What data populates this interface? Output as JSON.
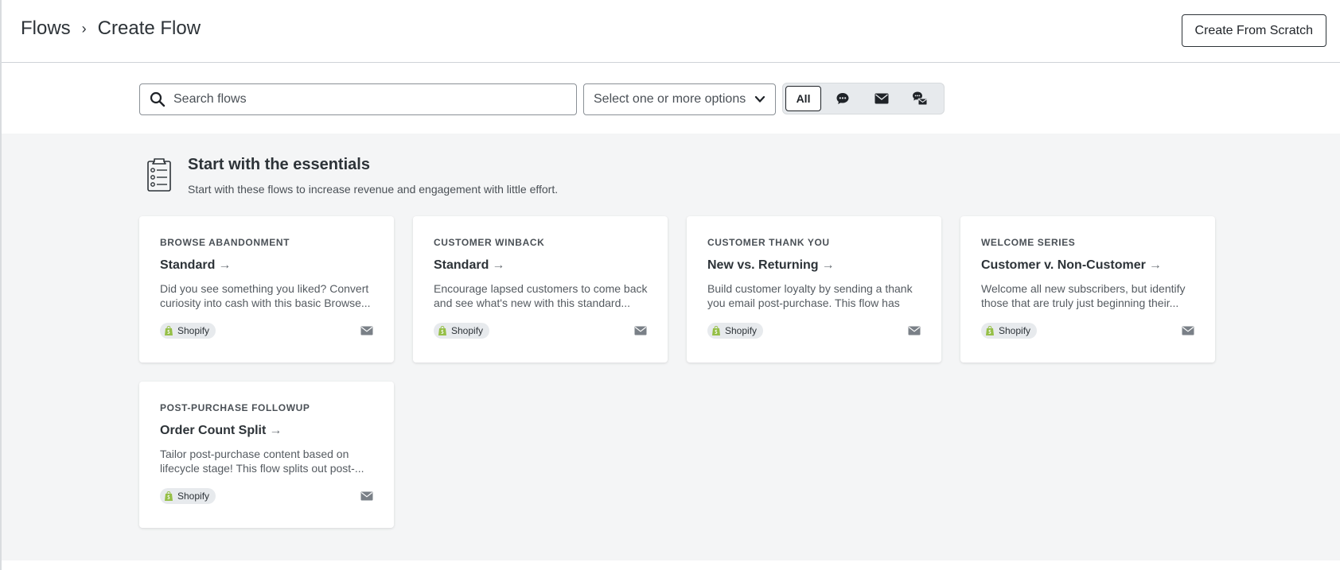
{
  "header": {
    "breadcrumb_root": "Flows",
    "breadcrumb_separator": "›",
    "breadcrumb_current": "Create Flow",
    "create_button": "Create From Scratch"
  },
  "toolbar": {
    "search_placeholder": "Search flows",
    "select_placeholder": "Select one or more options",
    "filters": [
      {
        "label": "All",
        "icon": null,
        "active": true
      },
      {
        "label": "",
        "icon": "sms-icon",
        "active": false
      },
      {
        "label": "",
        "icon": "email-icon",
        "active": false
      },
      {
        "label": "",
        "icon": "sms-email-icon",
        "active": false
      }
    ]
  },
  "section": {
    "title": "Start with the essentials",
    "subtitle": "Start with these flows to increase revenue and engagement with little effort.",
    "icon": "clipboard-list-icon"
  },
  "cards": [
    {
      "category": "BROWSE ABANDONMENT",
      "name": "Standard",
      "description": "Did you see something you liked? Convert curiosity into cash with this basic Browse...",
      "tag": "Shopify",
      "channel": "email-icon"
    },
    {
      "category": "CUSTOMER WINBACK",
      "name": "Standard",
      "description": "Encourage lapsed customers to come back and see what's new with this standard...",
      "tag": "Shopify",
      "channel": "email-icon"
    },
    {
      "category": "CUSTOMER THANK YOU",
      "name": "New vs. Returning",
      "description": "Build customer loyalty by sending a thank you email post-purchase. This flow has spl...",
      "tag": "Shopify",
      "channel": "email-icon"
    },
    {
      "category": "WELCOME SERIES",
      "name": "Customer v. Non-Customer",
      "description": "Welcome all new subscribers, but identify those that are truly just beginning their...",
      "tag": "Shopify",
      "channel": "email-icon"
    },
    {
      "category": "POST-PURCHASE FOLLOWUP",
      "name": "Order Count Split",
      "description": "Tailor post-purchase content based on lifecycle stage! This flow splits out post-...",
      "tag": "Shopify",
      "channel": "email-icon"
    }
  ],
  "colors": {
    "background": "#f4f5f6",
    "shopify_green": "#95bf47",
    "text_primary": "#2d3338"
  }
}
